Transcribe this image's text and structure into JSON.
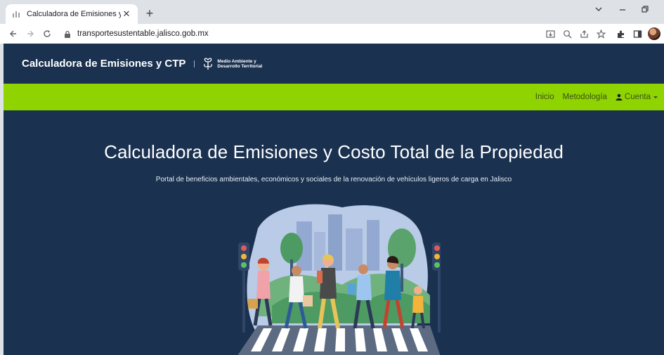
{
  "browser": {
    "tab_title": "Calculadora de Emisiones y CTP",
    "tab_close": "✕",
    "new_tab": "+",
    "url": "transportesustentable.jalisco.gob.mx",
    "icons": [
      "back-icon",
      "forward-icon",
      "reload-icon",
      "lock-icon",
      "install-icon",
      "zoom-icon",
      "share-icon",
      "bookmark-star-icon",
      "extensions-icon",
      "sidepanel-icon",
      "profile-avatar"
    ]
  },
  "header": {
    "brand": "Calculadora de Emisiones y CTP",
    "logo_line1": "Medio Ambiente y",
    "logo_line2": "Desarrollo Territorial"
  },
  "nav": {
    "inicio": "Inicio",
    "metodologia": "Metodología",
    "cuenta": "Cuenta"
  },
  "hero": {
    "title": "Calculadora de Emisiones y Costo Total de la Propiedad",
    "subtitle": "Portal de beneficios ambientales, económicos y sociales de la renovación de vehículos ligeros de carga en Jalisco"
  },
  "colors": {
    "page_bg": "#1a3150",
    "green_bar": "#8fd400"
  }
}
